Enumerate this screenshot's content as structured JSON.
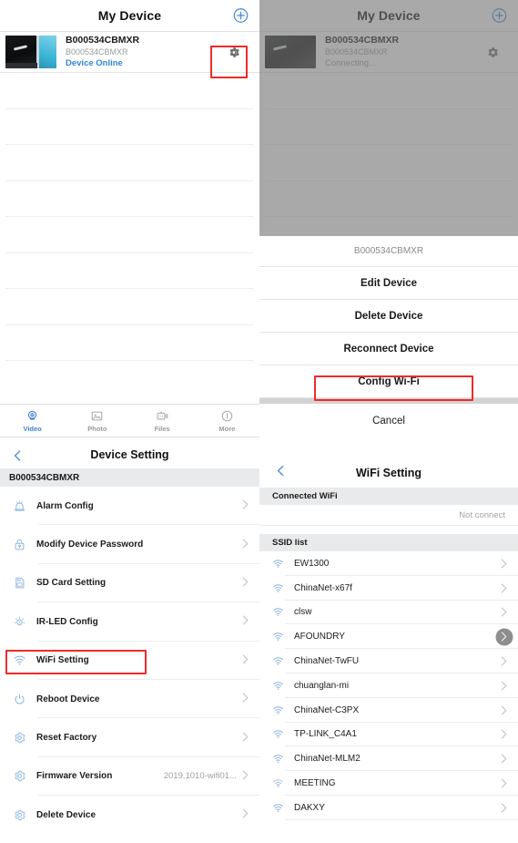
{
  "left_panel": {
    "device_list": {
      "nav_title": "My Device",
      "add_icon": "plus-circle-icon",
      "device": {
        "name": "B000534CBMXR",
        "uid": "B000534CBMXR",
        "status": "Device Online",
        "status_color": "#2f86d6",
        "gear_icon": "gear-icon"
      },
      "empty_row_count": 8
    },
    "tab_bar": {
      "tabs": [
        {
          "label": "Video",
          "icon": "camera-icon",
          "active": true
        },
        {
          "label": "Photo",
          "icon": "photo-icon",
          "active": false
        },
        {
          "label": "Files",
          "icon": "video-file-icon",
          "active": false
        },
        {
          "label": "More",
          "icon": "info-circle-icon",
          "active": false
        }
      ],
      "active_color": "#3d7fd6",
      "inactive_color": "#9a9a9a"
    },
    "device_setting": {
      "back_icon": "chevron-left-icon",
      "title": "Device Setting",
      "section_header": "B000534CBMXR",
      "rows": [
        {
          "label": "Alarm Config",
          "icon": "alarm-bell-icon",
          "value": ""
        },
        {
          "label": "Modify Device Password",
          "icon": "lock-icon",
          "value": ""
        },
        {
          "label": "SD Card Setting",
          "icon": "sd-card-icon",
          "value": ""
        },
        {
          "label": "IR-LED Config",
          "icon": "ir-led-icon",
          "value": ""
        },
        {
          "label": "WiFi Setting",
          "icon": "wifi-icon",
          "value": ""
        },
        {
          "label": "Reboot Device",
          "icon": "power-icon",
          "value": ""
        },
        {
          "label": "Reset Factory",
          "icon": "gear-icon",
          "value": ""
        },
        {
          "label": "Firmware Version",
          "icon": "gear-icon",
          "value": "2019.1010-wifi01..."
        },
        {
          "label": "Delete Device",
          "icon": "gear-icon",
          "value": ""
        }
      ],
      "chevron_icon": "chevron-right-icon"
    }
  },
  "right_panel": {
    "device_list": {
      "nav_title": "My Device",
      "add_icon": "plus-circle-icon",
      "device": {
        "name": "B000534CBMXR",
        "uid": "B000534CBMXR",
        "status": "Connecting...",
        "gear_icon": "gear-icon"
      },
      "dimmed": true
    },
    "action_sheet": {
      "header": "B000534CBMXR",
      "items": [
        {
          "label": "Edit Device"
        },
        {
          "label": "Delete Device"
        },
        {
          "label": "Reconnect Device"
        },
        {
          "label": "Config Wi-Fi"
        }
      ],
      "cancel_label": "Cancel"
    },
    "wifi_setting": {
      "back_icon": "chevron-left-icon",
      "title": "WiFi Setting",
      "connected_section": "Connected WiFi",
      "connected_value": "Not connect",
      "ssid_section": "SSID list",
      "chevron_icon": "chevron-right-icon",
      "ssids": [
        {
          "name": "EW1300",
          "icon": "wifi-icon",
          "pressed": false
        },
        {
          "name": "ChinaNet-x67f",
          "icon": "wifi-icon",
          "pressed": false
        },
        {
          "name": "clsw",
          "icon": "wifi-icon",
          "pressed": false
        },
        {
          "name": "AFOUNDRY",
          "icon": "wifi-icon",
          "pressed": true
        },
        {
          "name": "ChinaNet-TwFU",
          "icon": "wifi-icon",
          "pressed": false
        },
        {
          "name": "chuanglan-mi",
          "icon": "wifi-icon",
          "pressed": false
        },
        {
          "name": "ChinaNet-C3PX",
          "icon": "wifi-icon",
          "pressed": false
        },
        {
          "name": "TP-LINK_C4A1",
          "icon": "wifi-icon",
          "pressed": false
        },
        {
          "name": "ChinaNet-MLM2",
          "icon": "wifi-icon",
          "pressed": false
        },
        {
          "name": "MEETING",
          "icon": "wifi-icon",
          "pressed": false
        },
        {
          "name": "DAKXY",
          "icon": "wifi-icon",
          "pressed": false
        }
      ]
    }
  },
  "annotations": {
    "highlight_color": "#ee2b2b",
    "boxes": [
      {
        "name": "gear-highlight",
        "target": "left device gear button"
      },
      {
        "name": "wifi-setting-highlight",
        "target": "WiFi Setting row"
      },
      {
        "name": "config-wifi-highlight",
        "target": "Config Wi-Fi action"
      }
    ]
  }
}
